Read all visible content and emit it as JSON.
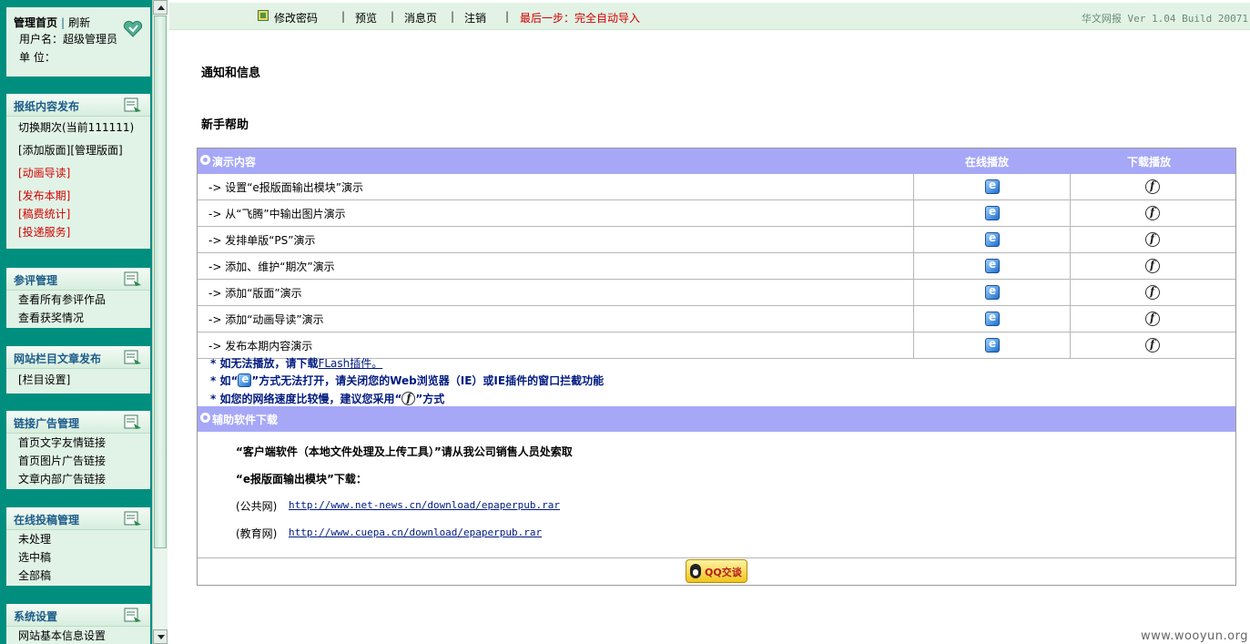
{
  "sidebar": {
    "user_panel": {
      "home_label": "管理首页",
      "separator": "|",
      "refresh_label": "刷新",
      "username_line": "用户名：超级管理员",
      "unit_line": "单  位："
    },
    "panels": [
      {
        "title": "报纸内容发布",
        "items": [
          {
            "label": "切换期次(当前111111)",
            "red": false
          },
          {
            "label": "[添加版面][管理版面]",
            "red": false
          },
          {
            "label": "[动画导读]",
            "red": true
          },
          {
            "label": "[发布本期]",
            "red": true
          },
          {
            "label": "[稿费统计]",
            "red": true
          },
          {
            "label": "[投递服务]",
            "red": true
          }
        ]
      },
      {
        "title": "参评管理",
        "items": [
          {
            "label": "查看所有参评作品",
            "red": false
          },
          {
            "label": "查看获奖情况",
            "red": false
          }
        ]
      },
      {
        "title": "网站栏目文章发布",
        "items": [
          {
            "label": "[栏目设置]",
            "red": false
          }
        ]
      },
      {
        "title": "链接广告管理",
        "items": [
          {
            "label": "首页文字友情链接",
            "red": false
          },
          {
            "label": "首页图片广告链接",
            "red": false
          },
          {
            "label": "文章内部广告链接",
            "red": false
          }
        ]
      },
      {
        "title": "在线投稿管理",
        "items": [
          {
            "label": "未处理",
            "red": false
          },
          {
            "label": "选中稿",
            "red": false
          },
          {
            "label": "全部稿",
            "red": false
          }
        ]
      },
      {
        "title": "系统设置",
        "items": [
          {
            "label": "网站基本信息设置",
            "red": false
          }
        ]
      }
    ]
  },
  "topbar": {
    "change_password": "修改密码",
    "sep": "|",
    "preview": "预览",
    "messages": "消息页",
    "logout": "注销",
    "last_step": "最后一步：完全自动导入",
    "build": "华文网报 Ver 1.04 Build 20071"
  },
  "main": {
    "notices_heading": "通知和信息",
    "help_heading": "新手帮助",
    "demo_table": {
      "header": {
        "caption": "演示内容",
        "online": "在线播放",
        "download": "下载播放"
      },
      "rows": [
        "-> 设置“e报版面输出模块”演示",
        "-> 从“飞腾”中输出图片演示",
        "-> 发排单版“PS”演示",
        "-> 添加、维护“期次”演示",
        "-> 添加“版面”演示",
        "-> 添加“动画导读”演示",
        "-> 发布本期内容演示"
      ]
    },
    "notes": {
      "n1_prefix": "* 如无法播放，请下载",
      "n1_link": "FLash插件。",
      "n2_prefix": "* 如“",
      "n2_suffix": "”方式无法打开，请关闭您的Web浏览器（IE）或IE插件的窗口拦截功能",
      "n3_prefix": "* 如您的网络速度比较慢，建议您采用“",
      "n3_suffix": "”方式"
    },
    "software": {
      "header": "辅助软件下载",
      "client_line": "“客户端软件（本地文件处理及上传工具）”请从我公司销售人员处索取",
      "module_line": "“e报版面输出模块”下载：",
      "public_label": "(公共网)",
      "public_url": "http://www.net-news.cn/download/epaperpub.rar",
      "edu_label": "(教育网)",
      "edu_url": "http://www.cuepa.cn/download/epaperpub.rar"
    },
    "qq_button": "QQ交谈"
  },
  "watermark": "www.wooyun.org"
}
